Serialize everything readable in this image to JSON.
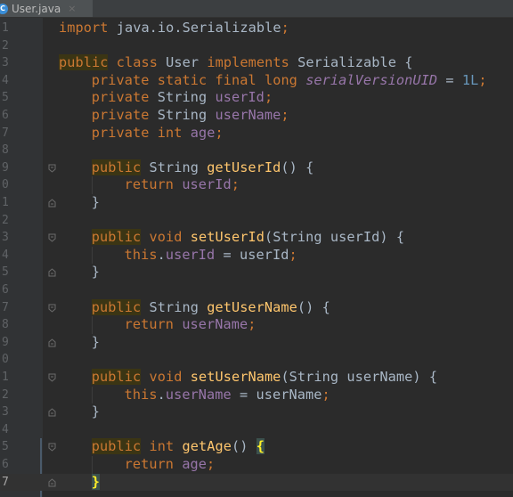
{
  "tab": {
    "filename": "User.java",
    "close": "×",
    "icon": "C"
  },
  "lines": [
    {
      "num": "1",
      "text": "import java.io.Serializable;"
    },
    {
      "num": "2",
      "text": ""
    },
    {
      "num": "3",
      "text": "public class User implements Serializable {"
    },
    {
      "num": "4",
      "text": "private static final long serialVersionUID = 1L;"
    },
    {
      "num": "5",
      "text": "private String userId;"
    },
    {
      "num": "6",
      "text": "private String userName;"
    },
    {
      "num": "7",
      "text": "private int age;"
    },
    {
      "num": "8",
      "text": ""
    },
    {
      "num": "9",
      "text": "public String getUserId() {"
    },
    {
      "num": "0",
      "text": "return userId;"
    },
    {
      "num": "1",
      "text": "}"
    },
    {
      "num": "2",
      "text": ""
    },
    {
      "num": "3",
      "text": "public void setUserId(String userId) {"
    },
    {
      "num": "4",
      "text": "this.userId = userId;"
    },
    {
      "num": "5",
      "text": "}"
    },
    {
      "num": "6",
      "text": ""
    },
    {
      "num": "7",
      "text": "public String getUserName() {"
    },
    {
      "num": "8",
      "text": "return userName;"
    },
    {
      "num": "9",
      "text": "}"
    },
    {
      "num": "0",
      "text": ""
    },
    {
      "num": "1",
      "text": "public void setUserName(String userName) {"
    },
    {
      "num": "2",
      "text": "this.userName = userName;"
    },
    {
      "num": "3",
      "text": "}"
    },
    {
      "num": "4",
      "text": ""
    },
    {
      "num": "5",
      "text": "public int getAge() {"
    },
    {
      "num": "6",
      "text": "return age;"
    },
    {
      "num": "7",
      "text": "}"
    }
  ],
  "colors": {
    "background": "#2b2b2b",
    "keyword": "#cc7832",
    "field": "#9876aa",
    "method": "#ffc66d",
    "number": "#6897bb",
    "plain": "#a9b7c6"
  }
}
